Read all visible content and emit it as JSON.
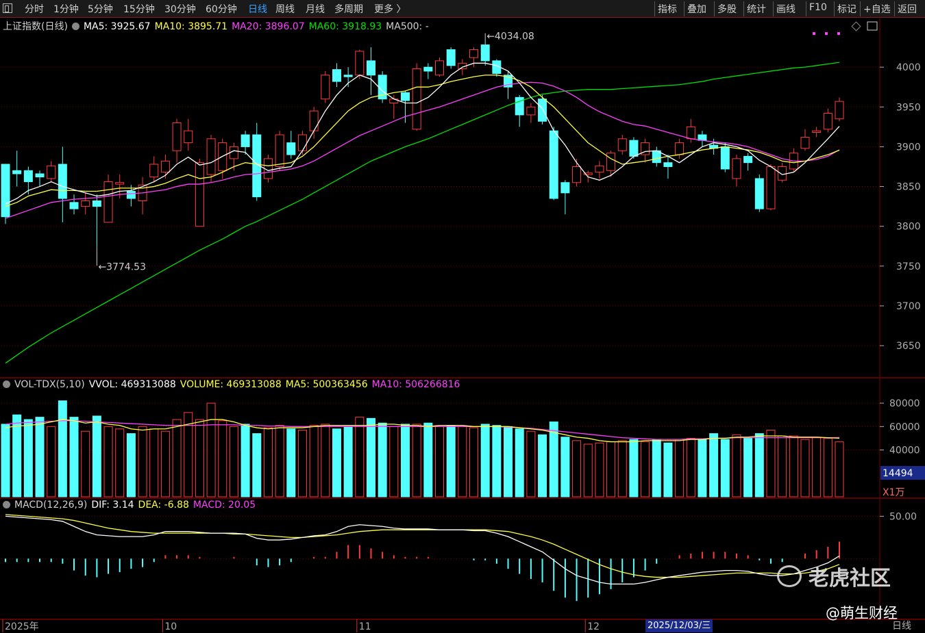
{
  "toolbar": {
    "left_items": [
      "分时",
      "1分钟",
      "5分钟",
      "15分钟",
      "30分钟",
      "60分钟",
      "日线",
      "周线",
      "月线",
      "多周期",
      "更多 〉"
    ],
    "active": "日线",
    "right_items": [
      "指标",
      "叠加",
      "多股",
      "统计",
      "画线",
      "F10",
      "标记",
      "+自选",
      "返回"
    ]
  },
  "main_legend": {
    "title": "上证指数(日线)",
    "ma5": "MA5: 3925.67",
    "ma10": "MA10: 3895.71",
    "ma20": "MA20: 3896.07",
    "ma60": "MA60: 3918.93",
    "ma500": "MA500: -"
  },
  "vol_legend": {
    "title": "VOL-TDX(5,10)",
    "vvol": "VVOL: 469313088",
    "volume": "VOLUME: 469313088",
    "ma5": "MA5: 500363456",
    "ma10": "MA10: 506266816"
  },
  "macd_legend": {
    "title": "MACD(12,26,9)",
    "dif": "DIF: 3.14",
    "dea": "DEA: -6.88",
    "macd": "MACD: 20.05"
  },
  "colors": {
    "up": "#ff3b3b",
    "down": "#54ffff",
    "ma5": "#ffffff",
    "ma10": "#ffff40",
    "ma20": "#ff40ff",
    "ma60": "#00e000",
    "grid": "#7a0000",
    "axis": "#b0b0b0"
  },
  "chart_data": [
    {
      "type": "candlestick",
      "title": "上证指数(日线)",
      "ylim": [
        3620,
        4050
      ],
      "yticks": [
        "4000",
        "3950",
        "3900",
        "3850",
        "3800",
        "3750",
        "3700",
        "3650"
      ],
      "ohlc": [
        [
          3878,
          3812,
          3803,
          3875
        ],
        [
          3870,
          3866,
          3850,
          3895
        ],
        [
          3870,
          3856,
          3840,
          3875
        ],
        [
          3866,
          3862,
          3850,
          3870
        ],
        [
          3860,
          3876,
          3855,
          3882
        ],
        [
          3878,
          3835,
          3805,
          3900
        ],
        [
          3830,
          3822,
          3815,
          3840
        ],
        [
          3825,
          3832,
          3815,
          3842
        ],
        [
          3832,
          3825,
          3774.53,
          3840
        ],
        [
          3805,
          3856,
          3805,
          3865
        ],
        [
          3853,
          3855,
          3835,
          3865
        ],
        [
          3844,
          3835,
          3825,
          3852
        ],
        [
          3832,
          3852,
          3815,
          3862
        ],
        [
          3862,
          3878,
          3855,
          3888
        ],
        [
          3868,
          3882,
          3860,
          3890
        ],
        [
          3895,
          3930,
          3880,
          3935
        ],
        [
          3905,
          3920,
          3895,
          3935
        ],
        [
          3800,
          3880,
          3800,
          3885
        ],
        [
          3865,
          3910,
          3855,
          3915
        ],
        [
          3870,
          3905,
          3860,
          3910
        ],
        [
          3885,
          3900,
          3870,
          3905
        ],
        [
          3915,
          3900,
          3890,
          3920
        ],
        [
          3915,
          3837,
          3832,
          3930
        ],
        [
          3860,
          3885,
          3855,
          3890
        ],
        [
          3875,
          3915,
          3870,
          3920
        ],
        [
          3905,
          3890,
          3885,
          3920
        ],
        [
          3895,
          3915,
          3890,
          3920
        ],
        [
          3920,
          3945,
          3910,
          3950
        ],
        [
          3960,
          3990,
          3955,
          3995
        ],
        [
          3997,
          3982,
          3975,
          4005
        ],
        [
          3990,
          3988,
          3975,
          4000
        ],
        [
          3990,
          4020,
          3985,
          4022
        ],
        [
          4008,
          3990,
          3965,
          4025
        ],
        [
          3990,
          3960,
          3955,
          3995
        ],
        [
          3955,
          3960,
          3935,
          3965
        ],
        [
          3968,
          3958,
          3930,
          3970
        ],
        [
          3922,
          3998,
          3920,
          4005
        ],
        [
          4000,
          3995,
          3985,
          4005
        ],
        [
          3990,
          4008,
          3988,
          4012
        ],
        [
          4022,
          4002,
          3998,
          4025
        ],
        [
          3998,
          4005,
          3990,
          4010
        ],
        [
          4012,
          4022,
          4000,
          4025
        ],
        [
          4028,
          4008,
          4002,
          4034.08
        ],
        [
          4008,
          3992,
          3988,
          4010
        ],
        [
          3990,
          3975,
          3960,
          3995
        ],
        [
          3962,
          3940,
          3925,
          3965
        ],
        [
          3940,
          3950,
          3930,
          3955
        ],
        [
          3960,
          3932,
          3928,
          3965
        ],
        [
          3920,
          3835,
          3833,
          3925
        ],
        [
          3855,
          3842,
          3815,
          3858
        ],
        [
          3855,
          3875,
          3850,
          3885
        ],
        [
          3865,
          3867,
          3855,
          3870
        ],
        [
          3868,
          3876,
          3860,
          3882
        ],
        [
          3870,
          3892,
          3862,
          3895
        ],
        [
          3895,
          3910,
          3890,
          3915
        ],
        [
          3908,
          3888,
          3885,
          3912
        ],
        [
          3890,
          3905,
          3880,
          3910
        ],
        [
          3895,
          3880,
          3875,
          3900
        ],
        [
          3880,
          3875,
          3860,
          3890
        ],
        [
          3890,
          3905,
          3885,
          3910
        ],
        [
          3910,
          3925,
          3905,
          3935
        ],
        [
          3915,
          3908,
          3900,
          3920
        ],
        [
          3902,
          3898,
          3890,
          3910
        ],
        [
          3900,
          3872,
          3868,
          3905
        ],
        [
          3860,
          3885,
          3850,
          3890
        ],
        [
          3888,
          3880,
          3870,
          3892
        ],
        [
          3860,
          3822,
          3818,
          3865
        ],
        [
          3822,
          3875,
          3820,
          3878
        ],
        [
          3858,
          3875,
          3855,
          3880
        ],
        [
          3872,
          3892,
          3868,
          3898
        ],
        [
          3898,
          3912,
          3895,
          3922
        ],
        [
          3918,
          3920,
          3912,
          3925
        ],
        [
          3922,
          3942,
          3918,
          3948
        ],
        [
          3935,
          3957,
          3932,
          3962
        ]
      ],
      "ma5": [
        3828,
        3835,
        3845,
        3850,
        3856,
        3850,
        3846,
        3842,
        3838,
        3840,
        3844,
        3845,
        3850,
        3856,
        3864,
        3878,
        3887,
        3877,
        3880,
        3888,
        3895,
        3893,
        3878,
        3870,
        3873,
        3875,
        3895,
        3920,
        3945,
        3965,
        3980,
        3990,
        3985,
        3970,
        3960,
        3955,
        3955,
        3962,
        3975,
        3990,
        4000,
        4005,
        4005,
        4002,
        3995,
        3980,
        3962,
        3948,
        3920,
        3902,
        3880,
        3862,
        3858,
        3864,
        3875,
        3888,
        3894,
        3895,
        3888,
        3880,
        3890,
        3900,
        3905,
        3903,
        3900,
        3895,
        3883,
        3875,
        3865,
        3868,
        3880,
        3895,
        3910,
        3925.67
      ],
      "ma10": [
        3825,
        3830,
        3838,
        3842,
        3846,
        3845,
        3845,
        3844,
        3844,
        3846,
        3848,
        3848,
        3848,
        3850,
        3854,
        3860,
        3865,
        3860,
        3862,
        3868,
        3875,
        3880,
        3878,
        3876,
        3878,
        3880,
        3888,
        3900,
        3915,
        3930,
        3945,
        3955,
        3962,
        3965,
        3968,
        3970,
        3975,
        3975,
        3978,
        3982,
        3985,
        3988,
        3990,
        3990,
        3988,
        3983,
        3975,
        3962,
        3950,
        3935,
        3920,
        3905,
        3895,
        3885,
        3878,
        3880,
        3882,
        3885,
        3888,
        3890,
        3893,
        3896,
        3898,
        3900,
        3898,
        3896,
        3893,
        3888,
        3882,
        3880,
        3882,
        3886,
        3890,
        3895.71
      ],
      "ma20": [
        3810,
        3815,
        3820,
        3825,
        3830,
        3832,
        3834,
        3835,
        3836,
        3838,
        3840,
        3841,
        3842,
        3844,
        3846,
        3850,
        3853,
        3853,
        3855,
        3858,
        3862,
        3865,
        3866,
        3868,
        3870,
        3872,
        3876,
        3882,
        3890,
        3898,
        3906,
        3914,
        3920,
        3926,
        3932,
        3938,
        3942,
        3946,
        3950,
        3955,
        3960,
        3965,
        3970,
        3975,
        3978,
        3980,
        3981,
        3980,
        3976,
        3970,
        3962,
        3952,
        3944,
        3938,
        3932,
        3928,
        3926,
        3922,
        3918,
        3914,
        3910,
        3908,
        3906,
        3905,
        3903,
        3900,
        3895,
        3890,
        3885,
        3882,
        3882,
        3884,
        3888,
        3896.07
      ],
      "ma60": [
        3628,
        3638,
        3648,
        3657,
        3666,
        3674,
        3682,
        3690,
        3698,
        3706,
        3714,
        3722,
        3730,
        3738,
        3746,
        3754,
        3762,
        3770,
        3777,
        3784,
        3792,
        3800,
        3806,
        3813,
        3820,
        3827,
        3834,
        3842,
        3850,
        3858,
        3866,
        3874,
        3882,
        3888,
        3894,
        3900,
        3905,
        3910,
        3916,
        3922,
        3928,
        3934,
        3940,
        3946,
        3952,
        3957,
        3962,
        3966,
        3968,
        3970,
        3971,
        3972,
        3972,
        3972,
        3973,
        3974,
        3975,
        3976,
        3977,
        3978,
        3980,
        3982,
        3985,
        3987,
        3989,
        3991,
        3993,
        3995,
        3997,
        3999,
        4000,
        4002,
        4004,
        4006
      ],
      "annotations": [
        "3774.53",
        "4034.08"
      ]
    },
    {
      "type": "bar",
      "title": "VOL-TDX(5,10)",
      "ylim": [
        0,
        90000
      ],
      "yticks": [
        "80000",
        "60000",
        "40000"
      ],
      "unit": "X1万",
      "current": "14494",
      "values": [
        62000,
        70000,
        66000,
        68000,
        60000,
        82000,
        68000,
        56000,
        69000,
        60000,
        58000,
        54000,
        60000,
        58000,
        56000,
        66000,
        72000,
        66000,
        80000,
        65000,
        60000,
        62000,
        54000,
        59000,
        61000,
        58000,
        57000,
        61000,
        62000,
        58000,
        60000,
        68000,
        67000,
        63000,
        60000,
        62000,
        62000,
        63000,
        60000,
        61000,
        60000,
        59000,
        62000,
        61000,
        60000,
        58000,
        56000,
        53000,
        64000,
        51000,
        48000,
        45000,
        46000,
        47000,
        48000,
        49000,
        47000,
        49000,
        46000,
        49000,
        50000,
        49000,
        54000,
        49000,
        53000,
        50000,
        54000,
        57000,
        52000,
        52000,
        49000,
        51000,
        50000,
        46931
      ],
      "ma5": [
        59000,
        60500,
        61000,
        62000,
        64000,
        66000,
        65000,
        63000,
        64000,
        62000,
        61000,
        58000,
        57000,
        58000,
        58000,
        60000,
        62000,
        64000,
        66000,
        66000,
        64000,
        61000,
        59000,
        58000,
        59000,
        59000,
        59000,
        60000,
        61000,
        61000,
        61000,
        61000,
        61000,
        62000,
        62000,
        61000,
        61000,
        60000,
        61000,
        61000,
        61000,
        60000,
        60000,
        60000,
        60000,
        59000,
        58000,
        57000,
        55000,
        53000,
        51000,
        50000,
        48000,
        47000,
        47000,
        47000,
        48000,
        48000,
        48000,
        48000,
        49000,
        49000,
        50000,
        50000,
        51000,
        51000,
        52000,
        52000,
        52000,
        51000,
        51000,
        51000,
        50500,
        50036
      ],
      "ma10": [
        62000,
        63000,
        63500,
        64000,
        64500,
        65000,
        65000,
        64500,
        64000,
        63500,
        63000,
        62500,
        62000,
        61500,
        61000,
        61000,
        61000,
        61000,
        61500,
        61500,
        61500,
        61000,
        61000,
        60500,
        60500,
        60000,
        60000,
        60000,
        60000,
        60000,
        60000,
        60000,
        60000,
        60000,
        60000,
        60000,
        60000,
        60000,
        60000,
        60000,
        60000,
        60000,
        60000,
        60000,
        59500,
        59000,
        58500,
        57500,
        56500,
        55500,
        54500,
        53500,
        52500,
        51500,
        50500,
        50000,
        49500,
        49000,
        49000,
        49000,
        49500,
        49500,
        50000,
        50000,
        50500,
        50500,
        50500,
        50500,
        50500,
        50500,
        50500,
        50500,
        50500,
        50627
      ]
    },
    {
      "type": "line",
      "title": "MACD(12,26,9)",
      "ylim": [
        -70,
        60
      ],
      "yticks": [
        "50.00"
      ],
      "dif": [
        50,
        49,
        48,
        47,
        46,
        44,
        38,
        32,
        28,
        27,
        26,
        26,
        26,
        28,
        32,
        32,
        32,
        31,
        30,
        30,
        30,
        29,
        24,
        22,
        22,
        23,
        25,
        27,
        28,
        32,
        38,
        40,
        39,
        38,
        36,
        35,
        35,
        35,
        34,
        34,
        34,
        33,
        33,
        30,
        26,
        20,
        14,
        8,
        -2,
        -12,
        -20,
        -24,
        -28,
        -30,
        -30,
        -30,
        -28,
        -25,
        -22,
        -20,
        -18,
        -16,
        -15,
        -14,
        -14,
        -15,
        -18,
        -20,
        -20,
        -18,
        -14,
        -10,
        -5,
        3.14
      ],
      "dea": [
        52,
        51,
        50,
        49,
        48,
        47,
        45,
        42,
        39,
        36,
        34,
        32,
        31,
        30,
        30,
        30,
        30,
        30,
        30,
        30,
        29,
        29,
        28,
        27,
        26,
        25,
        25,
        26,
        27,
        28,
        30,
        32,
        33,
        34,
        34,
        34,
        34,
        34,
        34,
        34,
        34,
        34,
        34,
        33,
        32,
        29,
        26,
        22,
        17,
        11,
        5,
        -1,
        -7,
        -12,
        -16,
        -19,
        -21,
        -22,
        -22,
        -22,
        -21,
        -20,
        -19,
        -18,
        -17,
        -17,
        -17,
        -17,
        -18,
        -18,
        -17,
        -15,
        -12,
        -6.88
      ],
      "macd": [
        -4,
        -4,
        -4,
        -4,
        -4,
        -6,
        -14,
        -20,
        -22,
        -18,
        -16,
        -12,
        -10,
        -4,
        4,
        4,
        4,
        2,
        0,
        0,
        2,
        0,
        -8,
        -10,
        -8,
        -4,
        0,
        2,
        2,
        8,
        16,
        16,
        12,
        8,
        4,
        2,
        2,
        2,
        0,
        0,
        0,
        -2,
        -2,
        -6,
        -12,
        -18,
        -24,
        -28,
        -38,
        -46,
        -50,
        -46,
        -42,
        -36,
        -28,
        -22,
        -14,
        -6,
        0,
        4,
        6,
        8,
        8,
        8,
        6,
        4,
        -2,
        -6,
        -4,
        0,
        6,
        10,
        14,
        20.05
      ]
    }
  ],
  "xaxis": {
    "labels": [
      {
        "text": "2025年",
        "idx": 0
      },
      {
        "text": "10",
        "idx": 14
      },
      {
        "text": "11",
        "idx": 31
      },
      {
        "text": "12",
        "idx": 51
      }
    ],
    "current_date": "2025/12/03/三",
    "period": "日线"
  },
  "watermark": {
    "text": "老虎社区",
    "author": "@萌生财经"
  }
}
